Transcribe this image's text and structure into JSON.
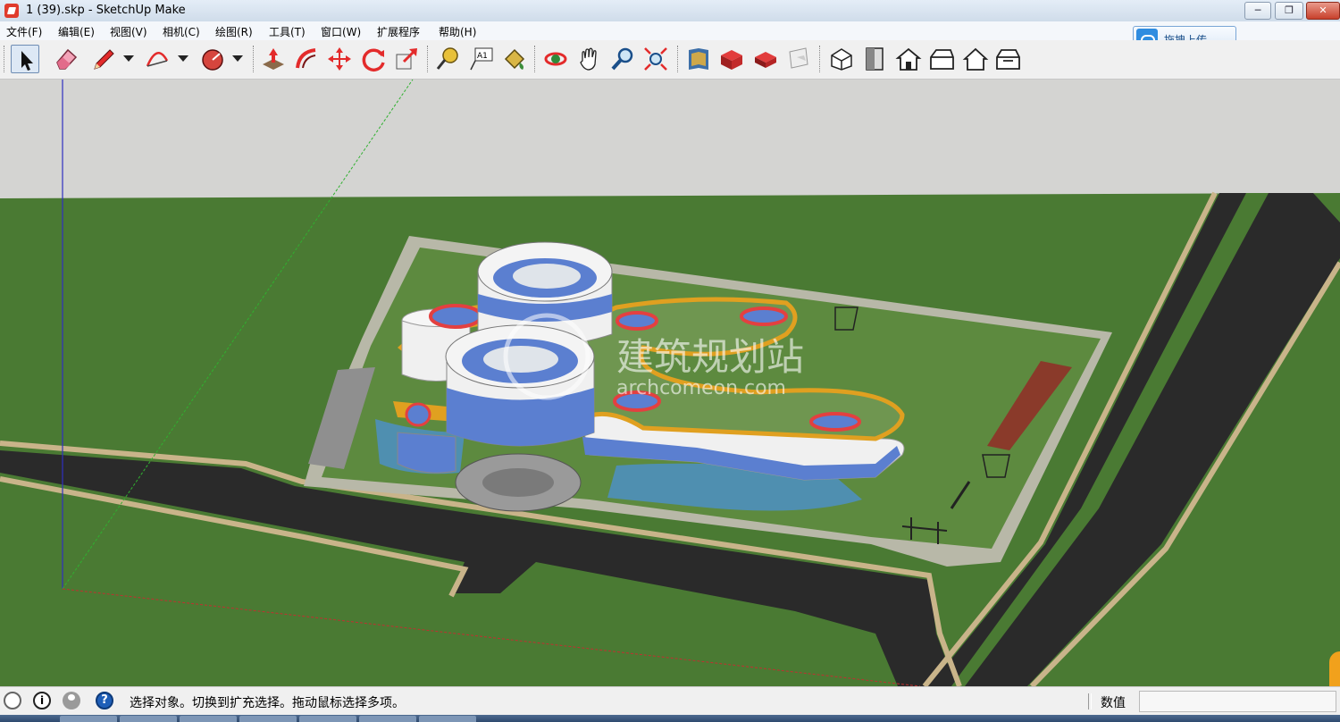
{
  "window": {
    "title": "1 (39).skp - SketchUp Make",
    "min_symbol": "─",
    "max_symbol": "❐",
    "close_symbol": "✕"
  },
  "menu": [
    "文件(F)",
    "编辑(E)",
    "视图(V)",
    "相机(C)",
    "绘图(R)",
    "工具(T)",
    "窗口(W)",
    "扩展程序",
    "帮助(H)"
  ],
  "upload": {
    "label": "拖拽上传",
    "icon": "cloud-icon"
  },
  "toolbar": {
    "tools": [
      {
        "name": "select-tool-button",
        "icon": "arrow-icon"
      },
      {
        "name": "eraser-tool-button",
        "icon": "eraser-icon"
      },
      {
        "name": "line-tool-button",
        "icon": "pencil-icon"
      },
      {
        "name": "arc-tool-button",
        "icon": "arc-icon"
      },
      {
        "name": "shape-tool-button",
        "icon": "polygon-icon"
      },
      {
        "name": "push-pull-tool-button",
        "icon": "push-pull-icon"
      },
      {
        "name": "follow-me-tool-button",
        "icon": "follow-me-icon"
      },
      {
        "name": "move-tool-button",
        "icon": "move-icon"
      },
      {
        "name": "rotate-tool-button",
        "icon": "rotate-icon"
      },
      {
        "name": "scale-tool-button",
        "icon": "scale-icon"
      },
      {
        "name": "tape-measure-tool-button",
        "icon": "tape-measure-icon"
      },
      {
        "name": "text-tool-button",
        "icon": "text-icon"
      },
      {
        "name": "paint-bucket-tool-button",
        "icon": "paint-bucket-icon"
      },
      {
        "name": "orbit-tool-button",
        "icon": "orbit-icon"
      },
      {
        "name": "pan-tool-button",
        "icon": "hand-icon"
      },
      {
        "name": "zoom-tool-button",
        "icon": "magnifier-icon"
      },
      {
        "name": "zoom-extents-tool-button",
        "icon": "zoom-extents-icon"
      },
      {
        "name": "warehouse-button",
        "icon": "warehouse-icon"
      },
      {
        "name": "share-model-button",
        "icon": "share-model-icon"
      },
      {
        "name": "components-button",
        "icon": "components-icon"
      },
      {
        "name": "layout-button",
        "icon": "layout-icon"
      },
      {
        "name": "iso-view-button",
        "icon": "iso-view-icon"
      },
      {
        "name": "top-view-button",
        "icon": "top-view-icon"
      },
      {
        "name": "front-view-button",
        "icon": "front-view-icon"
      },
      {
        "name": "right-view-button",
        "icon": "right-view-icon"
      },
      {
        "name": "back-view-button",
        "icon": "back-view-icon"
      },
      {
        "name": "left-view-button",
        "icon": "left-view-icon"
      }
    ],
    "text_tool_label": "A1"
  },
  "viewport": {
    "watermark_main": "建筑规划站",
    "watermark_sub": "archcomeon.com",
    "colors": {
      "sky": "#d4d4d2",
      "grass": "#4a7a33",
      "road": "#2a2a2a",
      "curb": "#c9b48a",
      "building": "#f0f0f0",
      "glass": "#5b7fd0",
      "accent_red": "#e34040",
      "walkway_orange": "#e0a020",
      "water": "#4f8fb0"
    }
  },
  "status": {
    "icons": [
      "geo-location-icon",
      "info-icon",
      "user-icon",
      "help-icon"
    ],
    "info_symbol": "i",
    "help_symbol": "?",
    "text": "选择对象。切换到扩充选择。拖动鼠标选择多项。",
    "vcb_label": "数值",
    "vcb_value": ""
  }
}
